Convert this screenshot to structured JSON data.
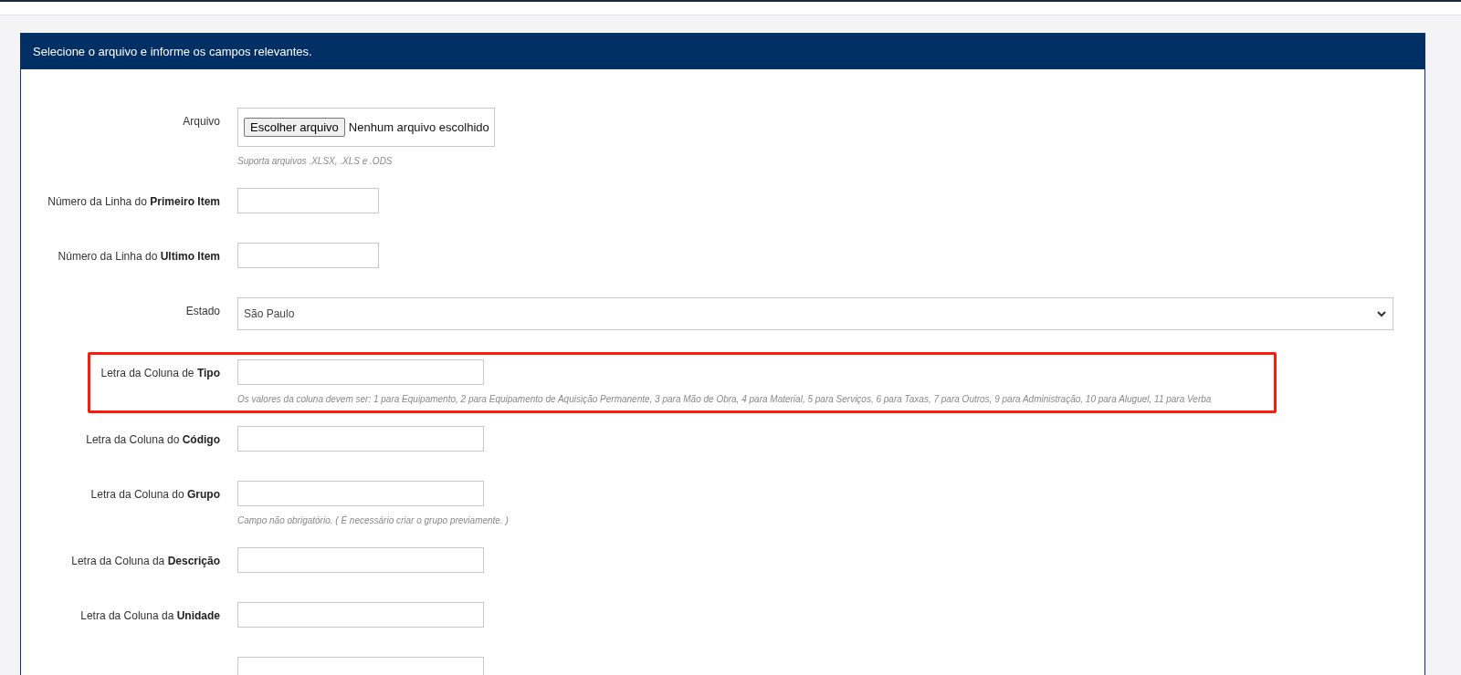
{
  "panel": {
    "title": "Selecione o arquivo e informe os campos relevantes."
  },
  "fields": [
    {
      "kind": "file",
      "label": "Arquivo",
      "button": "Escolher arquivo",
      "value": "Nenhum arquivo escolhido",
      "hint": "Suporta arquivos .XLSX, .XLS e .ODS",
      "highlighted": false
    },
    {
      "kind": "number",
      "label": "Número da Linha do **Primeiro Item**",
      "highlighted": false
    },
    {
      "kind": "number",
      "label": "Número da Linha do **Ultimo Item**",
      "highlighted": false
    },
    {
      "kind": "select",
      "label": "Estado",
      "value": "São Paulo",
      "highlighted": false
    },
    {
      "kind": "letter",
      "label": "Letra da Coluna de **Tipo**",
      "hint": "Os valores da coluna devem ser: 1 para Equipamento, 2 para Equipamento de Aquisição Permanente, 3 para Mão de Obra, 4 para Material, 5 para Serviços, 6 para Taxas, 7 para Outros, 9 para Administração, 10 para Aluguel, 11 para Verba",
      "highlighted": true
    },
    {
      "kind": "letter",
      "label": "Letra da Coluna do **Código**",
      "highlighted": false
    },
    {
      "kind": "letter",
      "label": "Letra da Coluna do **Grupo**",
      "hint": "Campo não obrigatório. ( É necessário criar o grupo previamente. )",
      "highlighted": false
    },
    {
      "kind": "letter",
      "label": "Letra da Coluna da **Descrição**",
      "highlighted": false
    },
    {
      "kind": "letter",
      "label": "Letra da Coluna da **Unidade**",
      "highlighted": false
    },
    {
      "kind": "letter",
      "highlighted": false
    }
  ]
}
